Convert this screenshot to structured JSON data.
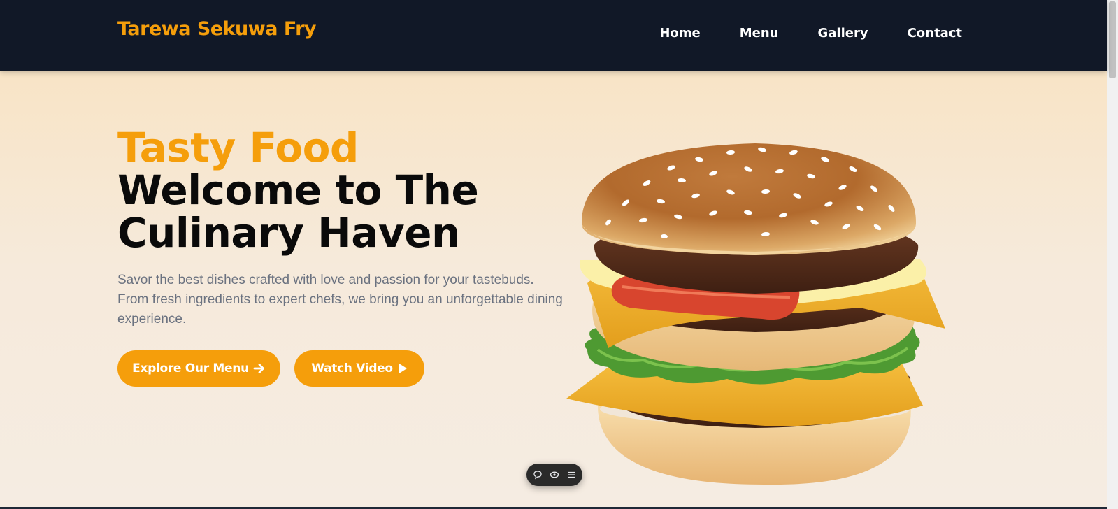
{
  "header": {
    "brand": "Tarewa Sekuwa Fry",
    "nav": [
      "Home",
      "Menu",
      "Gallery",
      "Contact"
    ]
  },
  "hero": {
    "headline_accent": "Tasty Food",
    "headline_rest": "Welcome to The Culinary Haven",
    "description": "Savor the best dishes crafted with love and passion for your tastebuds. From fresh ingredients to expert chefs, we bring you an unforgettable dining experience.",
    "primary_button": "Explore Our Menu",
    "secondary_button": "Watch Video",
    "image": "burger-image"
  },
  "toolbar": {
    "icons": [
      "comment-icon",
      "eye-icon",
      "menu-icon"
    ]
  },
  "colors": {
    "accent": "#f59e0b",
    "header_bg": "#111827",
    "hero_bg": "#f6eadb",
    "text_dark": "#0a0a0a",
    "text_muted": "#6b7280"
  }
}
